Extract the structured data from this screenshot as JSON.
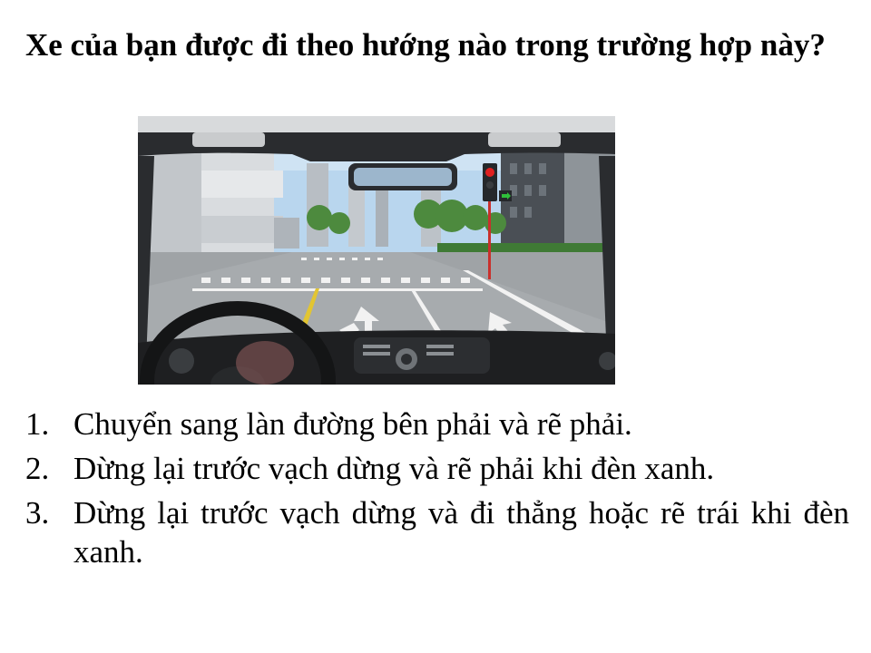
{
  "question": {
    "text": "Xe của bạn được đi theo hướng nào trong trường hợp này?"
  },
  "scene": {
    "alt_icon": "dashboard-view-intersection",
    "colors": {
      "sky": "#b9d6ee",
      "road": "#9fa3a6",
      "dashboard": "#1e1f21",
      "traffic_light_red": "#e02020",
      "traffic_light_green_arrow": "#2fbf3a"
    }
  },
  "answers": [
    {
      "number": "1.",
      "text": "Chuyển sang làn đường bên phải và rẽ phải."
    },
    {
      "number": "2.",
      "text": "Dừng lại trước vạch dừng và rẽ phải khi đèn xanh."
    },
    {
      "number": "3.",
      "text": "Dừng lại trước vạch dừng và đi thẳng hoặc rẽ trái khi đèn xanh."
    }
  ]
}
